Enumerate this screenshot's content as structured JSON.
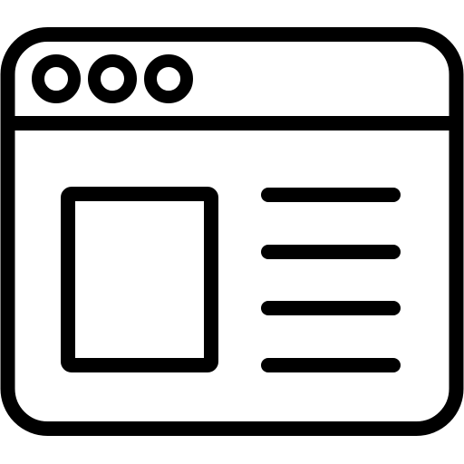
{
  "icon": {
    "name": "browser-window-icon",
    "stroke_color": "#000000",
    "fill_color": "#ffffff",
    "window_control_count": 3,
    "content_line_count": 4
  }
}
